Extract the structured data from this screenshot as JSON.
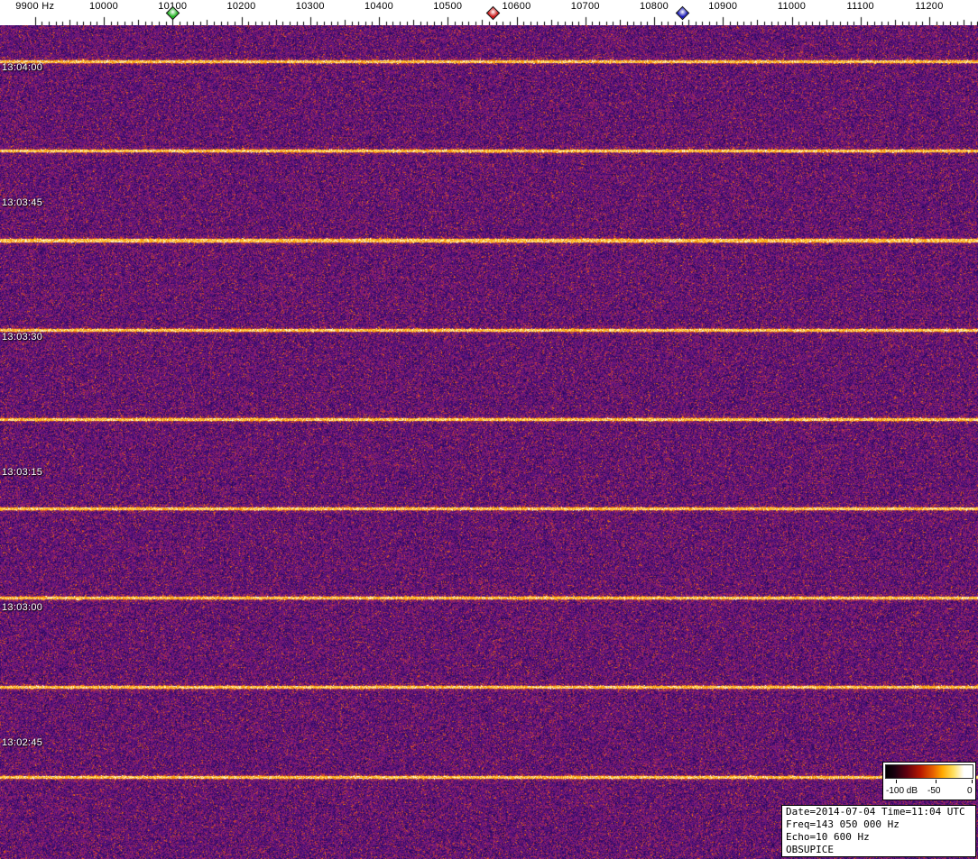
{
  "info_panel": {
    "lines": [
      "Date=2014-07-04 Time=11:04 UTC",
      "Freq=143 050 000 Hz",
      "Echo=10 600 Hz",
      "OBSUPICE"
    ]
  },
  "chart_data": {
    "type": "heatmap",
    "title": "Radio meteor echo spectrogram waterfall (OBSUPICE)",
    "x_axis": {
      "unit": "Hz",
      "range": [
        9850,
        11270
      ],
      "tick_step_hz": 100,
      "ticks": [
        {
          "label": "9900 Hz",
          "value": 9900
        },
        {
          "label": "10000",
          "value": 10000
        },
        {
          "label": "10100",
          "value": 10100
        },
        {
          "label": "10200",
          "value": 10200
        },
        {
          "label": "10300",
          "value": 10300
        },
        {
          "label": "10400",
          "value": 10400
        },
        {
          "label": "10500",
          "value": 10500
        },
        {
          "label": "10600",
          "value": 10600
        },
        {
          "label": "10700",
          "value": 10700
        },
        {
          "label": "10800",
          "value": 10800
        },
        {
          "label": "10900",
          "value": 10900
        },
        {
          "label": "11000",
          "value": 11000
        },
        {
          "label": "11100",
          "value": 11100
        },
        {
          "label": "11200",
          "value": 11200
        }
      ]
    },
    "y_axis": {
      "unit": "UTC time",
      "direction": "time increases upward",
      "tick_interval_s": 15,
      "ticks": [
        "13:04:00",
        "13:03:45",
        "13:03:30",
        "13:03:15",
        "13:03:00",
        "13:02:45"
      ]
    },
    "markers": [
      {
        "color_name": "green",
        "hex": "#1db31d",
        "freq_hz": 10100
      },
      {
        "color_name": "red",
        "hex": "#cc1111",
        "freq_hz": 10565
      },
      {
        "color_name": "blue",
        "hex": "#1515b8",
        "freq_hz": 10840
      }
    ],
    "bright_lines": {
      "count": 9,
      "interval_s": 10,
      "color": "#ffd24d",
      "description": "regular bright horizontal calibration/sweep lines across full bandwidth"
    },
    "colorbar": {
      "min_db": -100,
      "mid_db": -50,
      "max_db": 0,
      "labels": [
        "-100 dB",
        "-50",
        "0"
      ]
    },
    "noise_palette": [
      "#05001e",
      "#2a0860",
      "#5a1482",
      "#96206e",
      "#c83c28",
      "#eb780a",
      "#ffb414",
      "#ffe678",
      "#ffffff"
    ],
    "background_character": "dense purple noise floor with orange speckle, level roughly -70 dB"
  }
}
